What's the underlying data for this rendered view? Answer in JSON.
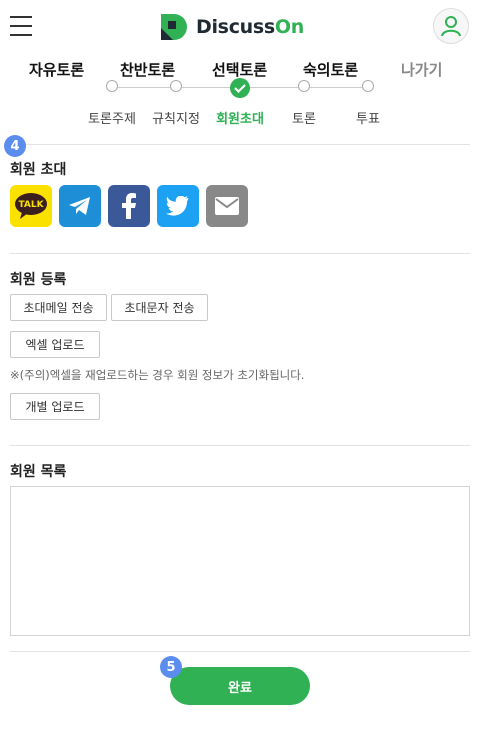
{
  "header": {
    "logo_text_main": "Discuss",
    "logo_text_accent": "On"
  },
  "topnav": {
    "items": [
      {
        "label": "자유토론"
      },
      {
        "label": "찬반토론"
      },
      {
        "label": "선택토론"
      },
      {
        "label": "숙의토론"
      },
      {
        "label": "나가기"
      }
    ]
  },
  "stepper": {
    "steps": [
      {
        "label": "토론주제",
        "active": false
      },
      {
        "label": "규칙지정",
        "active": false
      },
      {
        "label": "회원초대",
        "active": true
      },
      {
        "label": "토론",
        "active": false
      },
      {
        "label": "투표",
        "active": false
      }
    ]
  },
  "invite": {
    "badge": "4",
    "title": "회원 초대",
    "share": [
      {
        "name": "kakao-talk",
        "text": "TALK"
      },
      {
        "name": "telegram"
      },
      {
        "name": "facebook"
      },
      {
        "name": "twitter"
      },
      {
        "name": "email"
      }
    ]
  },
  "register": {
    "title": "회원 등록",
    "email_invite": "초대메일 전송",
    "sms_invite": "초대문자 전송",
    "excel_upload": "엑셀 업로드",
    "notice": "※(주의)엑셀을 재업로드하는 경우 회원 정보가 초기화됩니다.",
    "single_upload": "개별 업로드"
  },
  "members": {
    "title": "회원 목록"
  },
  "footer": {
    "badge": "5",
    "complete_label": "완료"
  },
  "colors": {
    "brand_green": "#2fb154",
    "badge_blue": "#5b8def",
    "kakao": "#fae100",
    "telegram": "#1e8fd6",
    "facebook": "#3b5998",
    "twitter": "#1da1f2",
    "mail": "#888888"
  }
}
